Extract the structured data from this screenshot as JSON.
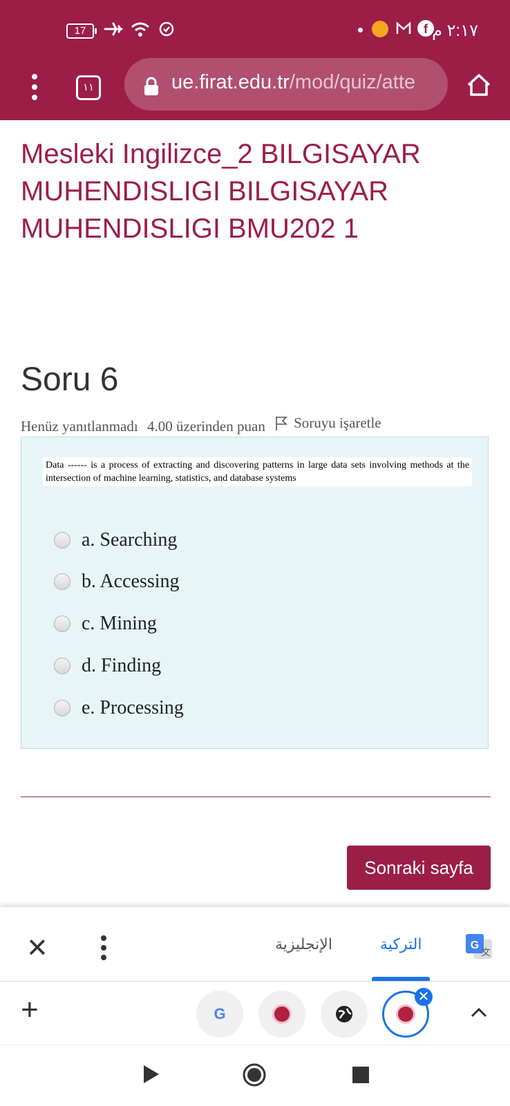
{
  "status_bar": {
    "battery": "17",
    "time": "٢:١٧ م"
  },
  "browser": {
    "tab_count": "١١",
    "url_host": "ue.firat.edu.tr",
    "url_path": "/mod/quiz/atte"
  },
  "page": {
    "course_title": "Mesleki Ingilizce_2 BILGISAYAR MUHENDISLIGI BILGISAYAR MUHENDISLIGI BMU202 1",
    "question_heading": "Soru 6",
    "status": "Henüz yanıtlanmadı",
    "points": "4.00 üzerinden puan",
    "flag_label": "Soruyu işaretle",
    "question_text": "Data ------ is a process of extracting and discovering patterns in large data sets involving methods at the intersection of machine learning, statistics, and database systems",
    "options": [
      "a. Searching",
      "b. Accessing",
      "c. Mining",
      "d. Finding",
      "e. Processing"
    ],
    "next_button": "Sonraki sayfa"
  },
  "translate_bar": {
    "source_lang": "التركية",
    "target_lang": "الإنجليزية"
  },
  "colors": {
    "brand": "#9c1e47",
    "question_bg": "#e7f5f7",
    "accent_blue": "#1a73e8"
  }
}
